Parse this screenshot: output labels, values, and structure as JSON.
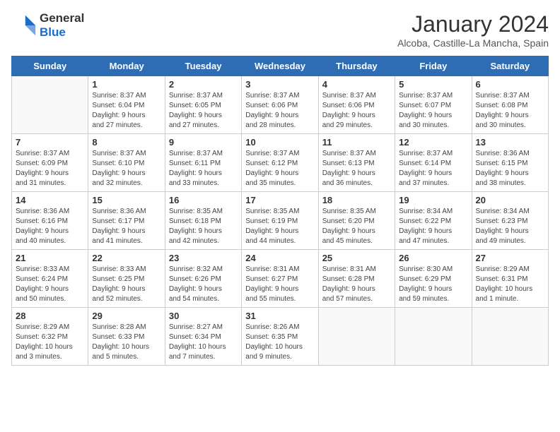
{
  "header": {
    "logo_line1": "General",
    "logo_line2": "Blue",
    "title": "January 2024",
    "subtitle": "Alcoba, Castille-La Mancha, Spain"
  },
  "days_of_week": [
    "Sunday",
    "Monday",
    "Tuesday",
    "Wednesday",
    "Thursday",
    "Friday",
    "Saturday"
  ],
  "weeks": [
    [
      {
        "day": "",
        "info": ""
      },
      {
        "day": "1",
        "info": "Sunrise: 8:37 AM\nSunset: 6:04 PM\nDaylight: 9 hours\nand 27 minutes."
      },
      {
        "day": "2",
        "info": "Sunrise: 8:37 AM\nSunset: 6:05 PM\nDaylight: 9 hours\nand 27 minutes."
      },
      {
        "day": "3",
        "info": "Sunrise: 8:37 AM\nSunset: 6:06 PM\nDaylight: 9 hours\nand 28 minutes."
      },
      {
        "day": "4",
        "info": "Sunrise: 8:37 AM\nSunset: 6:06 PM\nDaylight: 9 hours\nand 29 minutes."
      },
      {
        "day": "5",
        "info": "Sunrise: 8:37 AM\nSunset: 6:07 PM\nDaylight: 9 hours\nand 30 minutes."
      },
      {
        "day": "6",
        "info": "Sunrise: 8:37 AM\nSunset: 6:08 PM\nDaylight: 9 hours\nand 30 minutes."
      }
    ],
    [
      {
        "day": "7",
        "info": "Sunrise: 8:37 AM\nSunset: 6:09 PM\nDaylight: 9 hours\nand 31 minutes."
      },
      {
        "day": "8",
        "info": "Sunrise: 8:37 AM\nSunset: 6:10 PM\nDaylight: 9 hours\nand 32 minutes."
      },
      {
        "day": "9",
        "info": "Sunrise: 8:37 AM\nSunset: 6:11 PM\nDaylight: 9 hours\nand 33 minutes."
      },
      {
        "day": "10",
        "info": "Sunrise: 8:37 AM\nSunset: 6:12 PM\nDaylight: 9 hours\nand 35 minutes."
      },
      {
        "day": "11",
        "info": "Sunrise: 8:37 AM\nSunset: 6:13 PM\nDaylight: 9 hours\nand 36 minutes."
      },
      {
        "day": "12",
        "info": "Sunrise: 8:37 AM\nSunset: 6:14 PM\nDaylight: 9 hours\nand 37 minutes."
      },
      {
        "day": "13",
        "info": "Sunrise: 8:36 AM\nSunset: 6:15 PM\nDaylight: 9 hours\nand 38 minutes."
      }
    ],
    [
      {
        "day": "14",
        "info": "Sunrise: 8:36 AM\nSunset: 6:16 PM\nDaylight: 9 hours\nand 40 minutes."
      },
      {
        "day": "15",
        "info": "Sunrise: 8:36 AM\nSunset: 6:17 PM\nDaylight: 9 hours\nand 41 minutes."
      },
      {
        "day": "16",
        "info": "Sunrise: 8:35 AM\nSunset: 6:18 PM\nDaylight: 9 hours\nand 42 minutes."
      },
      {
        "day": "17",
        "info": "Sunrise: 8:35 AM\nSunset: 6:19 PM\nDaylight: 9 hours\nand 44 minutes."
      },
      {
        "day": "18",
        "info": "Sunrise: 8:35 AM\nSunset: 6:20 PM\nDaylight: 9 hours\nand 45 minutes."
      },
      {
        "day": "19",
        "info": "Sunrise: 8:34 AM\nSunset: 6:22 PM\nDaylight: 9 hours\nand 47 minutes."
      },
      {
        "day": "20",
        "info": "Sunrise: 8:34 AM\nSunset: 6:23 PM\nDaylight: 9 hours\nand 49 minutes."
      }
    ],
    [
      {
        "day": "21",
        "info": "Sunrise: 8:33 AM\nSunset: 6:24 PM\nDaylight: 9 hours\nand 50 minutes."
      },
      {
        "day": "22",
        "info": "Sunrise: 8:33 AM\nSunset: 6:25 PM\nDaylight: 9 hours\nand 52 minutes."
      },
      {
        "day": "23",
        "info": "Sunrise: 8:32 AM\nSunset: 6:26 PM\nDaylight: 9 hours\nand 54 minutes."
      },
      {
        "day": "24",
        "info": "Sunrise: 8:31 AM\nSunset: 6:27 PM\nDaylight: 9 hours\nand 55 minutes."
      },
      {
        "day": "25",
        "info": "Sunrise: 8:31 AM\nSunset: 6:28 PM\nDaylight: 9 hours\nand 57 minutes."
      },
      {
        "day": "26",
        "info": "Sunrise: 8:30 AM\nSunset: 6:29 PM\nDaylight: 9 hours\nand 59 minutes."
      },
      {
        "day": "27",
        "info": "Sunrise: 8:29 AM\nSunset: 6:31 PM\nDaylight: 10 hours\nand 1 minute."
      }
    ],
    [
      {
        "day": "28",
        "info": "Sunrise: 8:29 AM\nSunset: 6:32 PM\nDaylight: 10 hours\nand 3 minutes."
      },
      {
        "day": "29",
        "info": "Sunrise: 8:28 AM\nSunset: 6:33 PM\nDaylight: 10 hours\nand 5 minutes."
      },
      {
        "day": "30",
        "info": "Sunrise: 8:27 AM\nSunset: 6:34 PM\nDaylight: 10 hours\nand 7 minutes."
      },
      {
        "day": "31",
        "info": "Sunrise: 8:26 AM\nSunset: 6:35 PM\nDaylight: 10 hours\nand 9 minutes."
      },
      {
        "day": "",
        "info": ""
      },
      {
        "day": "",
        "info": ""
      },
      {
        "day": "",
        "info": ""
      }
    ]
  ]
}
